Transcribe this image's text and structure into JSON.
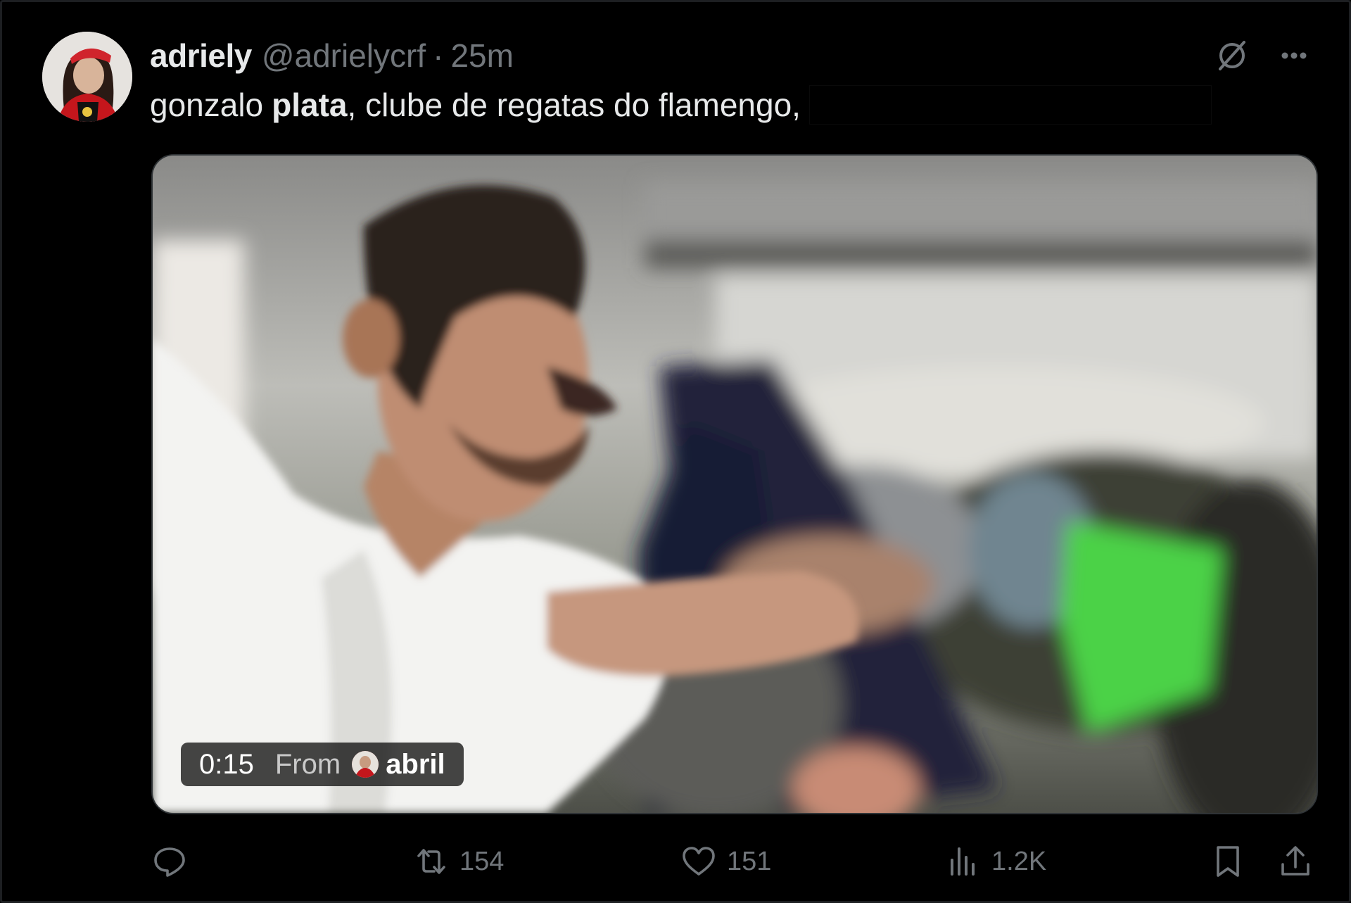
{
  "post": {
    "display_name": "adriely",
    "handle": "@adrielycrf",
    "separator": "·",
    "time": "25m",
    "text_part1": "gonzalo",
    "text_bold": "plata",
    "text_part2": ", clube de regatas do flamengo,"
  },
  "video": {
    "duration": "0:15",
    "from_label": "From",
    "source_name": "abril"
  },
  "actions": {
    "reply_count": "",
    "retweet_count": "154",
    "like_count": "151",
    "views_count": "1.2K"
  },
  "icons": {
    "top_right": [
      "grok-icon",
      "more-icon"
    ],
    "action_bar": [
      "reply-icon",
      "retweet-icon",
      "like-icon",
      "views-icon",
      "bookmark-icon",
      "share-icon"
    ]
  },
  "colors": {
    "background": "#000000",
    "primary_text": "#e7e9ea",
    "secondary_text": "#71767b"
  }
}
